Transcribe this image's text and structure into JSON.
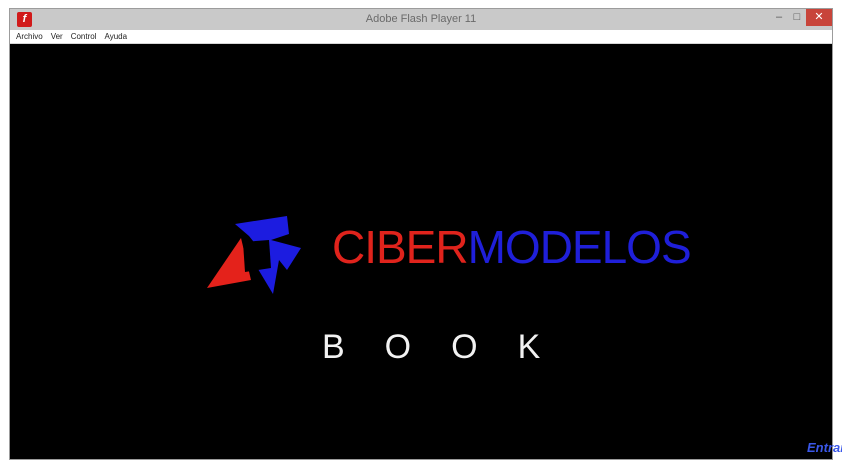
{
  "window": {
    "title": "Adobe Flash Player 11",
    "controls": {
      "minimize": "–",
      "maximize": "□",
      "close": "✕"
    }
  },
  "menubar": {
    "items": [
      "Archivo",
      "Ver",
      "Control",
      "Ayuda"
    ]
  },
  "splash": {
    "brand_red": "CIBER",
    "brand_blue": "MODELOS",
    "subtitle": "BOOK",
    "enter_button": "Entrar"
  },
  "colors": {
    "brand_red": "#e0231c",
    "brand_blue": "#1f1fd9",
    "background": "#000000"
  }
}
